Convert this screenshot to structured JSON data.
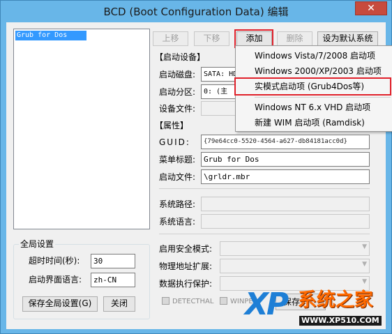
{
  "window": {
    "title": "BCD (Boot Configuration Data) 编辑"
  },
  "list": {
    "items": [
      "Grub for Dos"
    ]
  },
  "toolbar": {
    "up": "上移",
    "down": "下移",
    "add": "添加",
    "delete": "删除",
    "set_default": "设为默认系统"
  },
  "boot_device": {
    "section": "【启动设备】",
    "disk_label": "启动磁盘:",
    "disk_value": "SATA: HD",
    "partition_label": "启动分区:",
    "partition_value": "0: (主",
    "device_file_label": "设备文件:"
  },
  "properties": {
    "section": "【属性】",
    "guid_label": "GUID:",
    "guid_value": "{79e64cc0-5520-4564-a627-db84181acc0d}",
    "menu_title_label": "菜单标题:",
    "menu_title_value": "Grub for Dos",
    "boot_file_label": "启动文件:",
    "boot_file_value": "\\grldr.mbr",
    "system_path_label": "系统路径:",
    "system_lang_label": "系统语言:"
  },
  "advanced": {
    "safe_mode_label": "启用安全模式:",
    "pae_label": "物理地址扩展:",
    "dep_label": "数据执行保护:",
    "detecthal": "DETECTHAL",
    "winpe": "WINPE",
    "save_label": "保存"
  },
  "global": {
    "title": "全局设置",
    "timeout_label": "超时时间(秒):",
    "timeout_value": "30",
    "lang_label": "启动界面语言:",
    "lang_value": "zh-CN",
    "save_button": "保存全局设置(G)",
    "close_button": "关闭"
  },
  "menu": {
    "items": [
      "Windows Vista/7/2008 启动项",
      "Windows 2000/XP/2003 启动项",
      "实模式启动项 (Grub4Dos等)",
      "Windows NT 6.x VHD 启动项",
      "新建 WIM 启动项 (Ramdisk)"
    ]
  },
  "watermark": {
    "logo": "XP",
    "brand": "系统之家",
    "url": "WWW.XP510.COM"
  },
  "colors": {
    "frame": "#68b6e8",
    "highlight": "#e0202a",
    "list_selected": "#3399ff"
  }
}
